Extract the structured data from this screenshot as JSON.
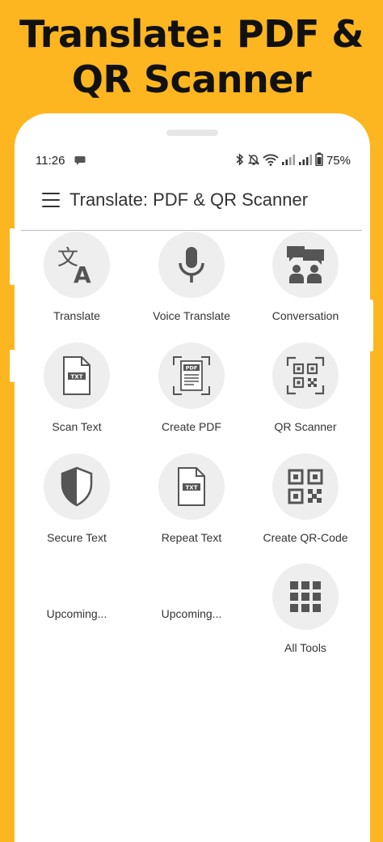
{
  "banner": {
    "title": "Translate: PDF & QR Scanner"
  },
  "status_bar": {
    "time": "11:26",
    "battery": "75%"
  },
  "app_bar": {
    "title": "Translate: PDF & QR Scanner"
  },
  "tools": [
    {
      "label": "Translate",
      "icon": "translate-icon"
    },
    {
      "label": "Voice Translate",
      "icon": "microphone-icon"
    },
    {
      "label": "Conversation",
      "icon": "conversation-icon"
    },
    {
      "label": "Scan Text",
      "icon": "txt-file-icon"
    },
    {
      "label": "Create PDF",
      "icon": "pdf-scan-icon"
    },
    {
      "label": "QR Scanner",
      "icon": "qr-scan-icon"
    },
    {
      "label": "Secure Text",
      "icon": "shield-icon"
    },
    {
      "label": "Repeat Text",
      "icon": "txt-file-icon"
    },
    {
      "label": "Create QR-Code",
      "icon": "qr-code-icon"
    },
    {
      "label": "Upcoming..."
    },
    {
      "label": "Upcoming..."
    },
    {
      "label": "All Tools",
      "icon": "grid-icon"
    }
  ]
}
